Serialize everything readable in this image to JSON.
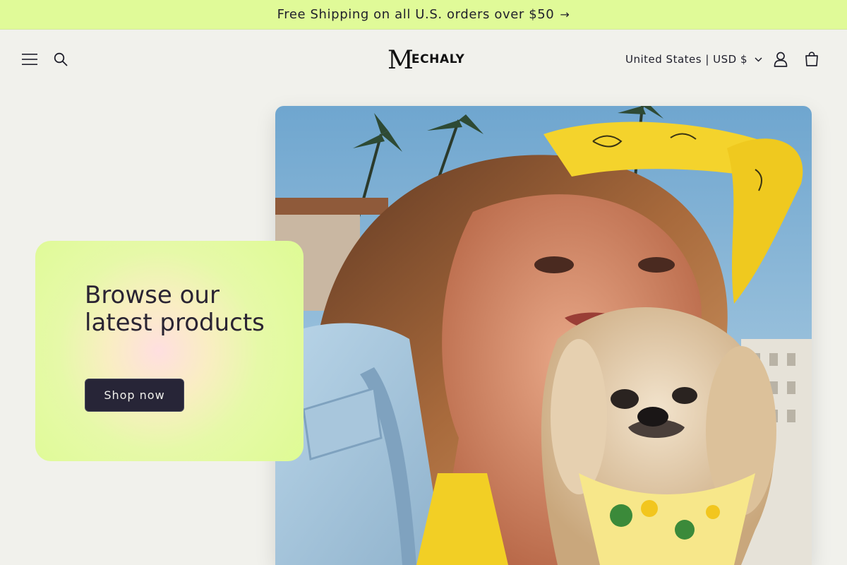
{
  "announcement": {
    "text": "Free Shipping on all U.S. orders over $50",
    "arrow": "→"
  },
  "header": {
    "logo_initial": "M",
    "logo_rest": "ECHALY",
    "country_selector": "United States | USD $",
    "icons": [
      "menu-icon",
      "search-icon",
      "chevron-down-icon",
      "account-icon",
      "cart-icon"
    ]
  },
  "hero": {
    "title": "Browse our latest products",
    "button_label": "Shop now"
  },
  "colors": {
    "announcement_bg": "#e0fa98",
    "page_bg": "#f1f1ec",
    "button_bg": "#272537",
    "card_gradient_center": "#ffdfe0",
    "card_gradient_edge": "#defb94"
  }
}
